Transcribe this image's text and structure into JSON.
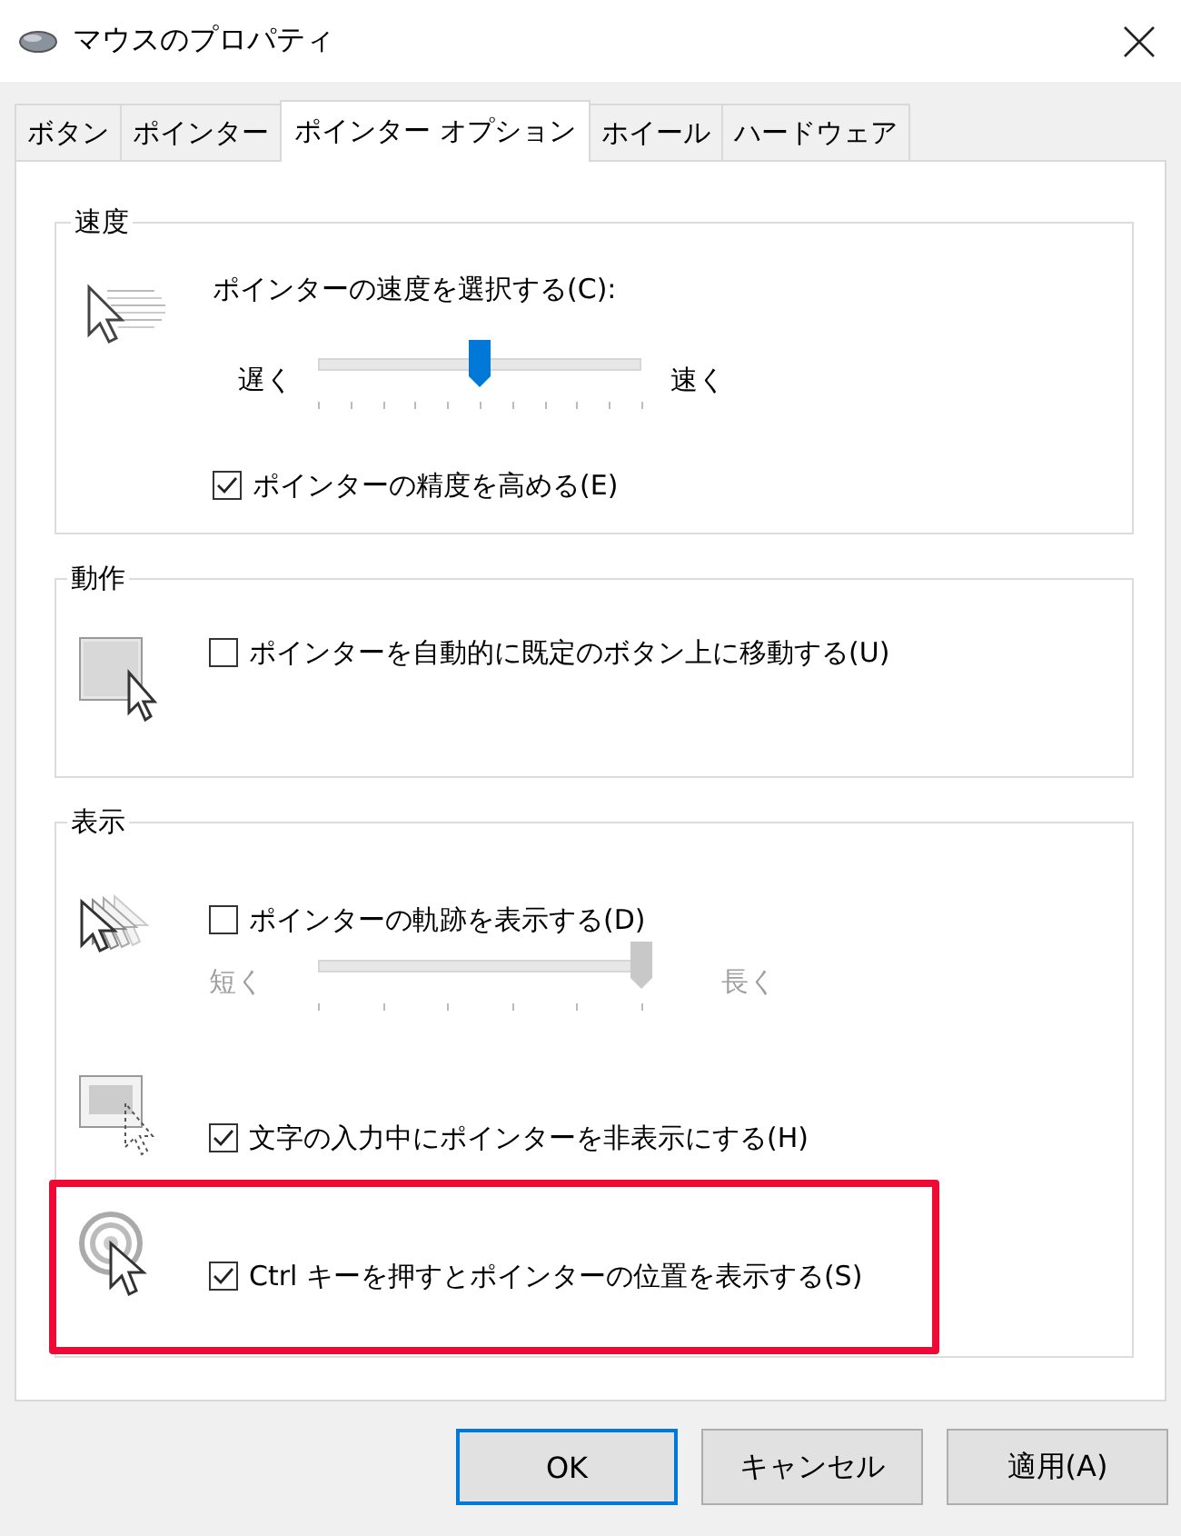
{
  "window": {
    "title": "マウスのプロパティ"
  },
  "tabs": [
    {
      "label": "ボタン",
      "selected": false
    },
    {
      "label": "ポインター",
      "selected": false
    },
    {
      "label": "ポインター オプション",
      "selected": true
    },
    {
      "label": "ホイール",
      "selected": false
    },
    {
      "label": "ハードウェア",
      "selected": false
    }
  ],
  "groups": [
    {
      "title": "速度",
      "blocks": [
        {
          "rows": [
            {
              "kind": "slider",
              "label": "ポインターの速度を選択する(C):",
              "min_label": "遅く",
              "max_label": "速く",
              "level": 0.5,
              "disabled": false
            },
            {
              "kind": "checkbox",
              "label": "ポインターの精度を高める(E)",
              "checked": true
            }
          ]
        }
      ]
    },
    {
      "title": "動作",
      "blocks": [
        {
          "rows": [
            {
              "kind": "checkbox",
              "label": "ポインターを自動的に既定のボタン上に移動する(U)",
              "checked": false
            }
          ]
        }
      ]
    },
    {
      "title": "表示",
      "blocks": [
        {
          "rows": [
            {
              "kind": "checkbox",
              "label": "ポインターの軌跡を表示する(D)",
              "checked": false
            },
            {
              "kind": "slider",
              "min_label": "短く",
              "max_label": "長く",
              "level": 1,
              "disabled": true
            }
          ]
        },
        {
          "rows": [
            {
              "kind": "checkbox",
              "label": "文字の入力中にポインターを非表示にする(H)",
              "checked": true
            }
          ]
        },
        {
          "highlighted": true,
          "rows": [
            {
              "kind": "checkbox",
              "label": "Ctrl キーを押すとポインターの位置を表示する(S)",
              "checked": true
            }
          ]
        }
      ]
    }
  ],
  "buttons": [
    {
      "label": "OK",
      "default": true
    },
    {
      "label": "キャンセル",
      "default": false
    },
    {
      "label": "適用(A)",
      "default": false
    }
  ]
}
